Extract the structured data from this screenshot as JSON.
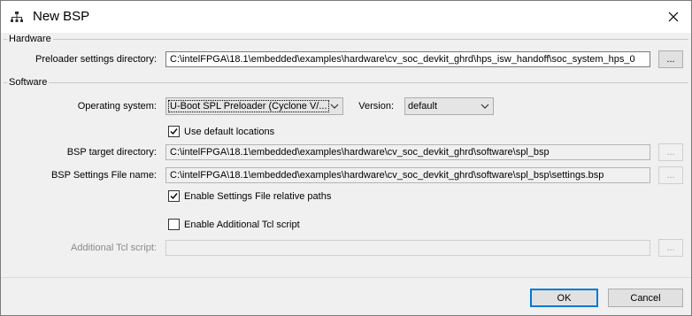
{
  "window": {
    "title": "New BSP"
  },
  "hardware": {
    "legend": "Hardware",
    "preloader_label": "Preloader settings directory:",
    "preloader_value": "C:\\intelFPGA\\18.1\\embedded\\examples\\hardware\\cv_soc_devkit_ghrd\\hps_isw_handoff\\soc_system_hps_0",
    "browse": "..."
  },
  "software": {
    "legend": "Software",
    "os_label": "Operating system:",
    "os_value": "U-Boot SPL Preloader (Cyclone V/...",
    "version_label": "Version:",
    "version_value": "default",
    "use_default_label": "Use default locations",
    "target_label": "BSP target directory:",
    "target_value": "C:\\intelFPGA\\18.1\\embedded\\examples\\hardware\\cv_soc_devkit_ghrd\\software\\spl_bsp",
    "settings_label": "BSP Settings File name:",
    "settings_value": "C:\\intelFPGA\\18.1\\embedded\\examples\\hardware\\cv_soc_devkit_ghrd\\software\\spl_bsp\\settings.bsp",
    "relative_label": "Enable Settings File relative paths",
    "tcl_enable_label": "Enable Additional Tcl script",
    "tcl_label": "Additional Tcl script:",
    "tcl_value": "",
    "browse": "..."
  },
  "footer": {
    "ok": "OK",
    "cancel": "Cancel"
  }
}
